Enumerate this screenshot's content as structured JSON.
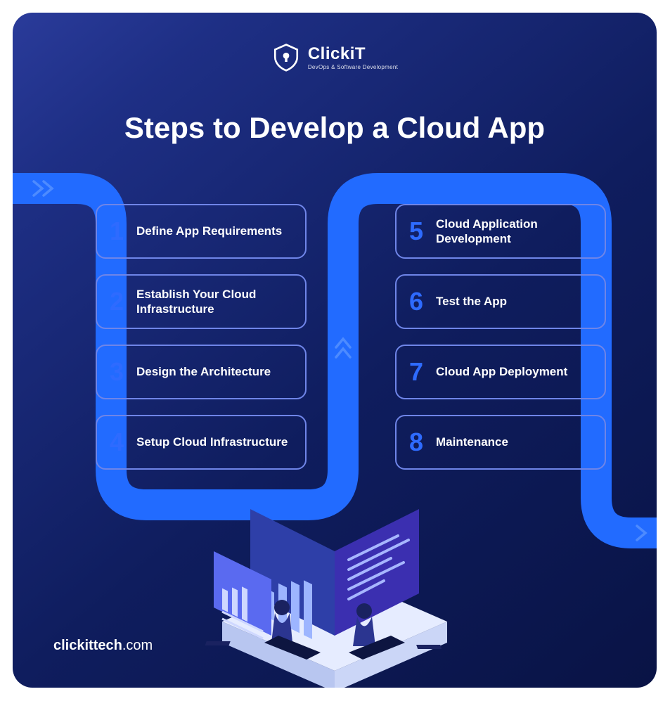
{
  "brand": {
    "name": "ClickiT",
    "tagline": "DevOps & Software Development"
  },
  "title": "Steps to Develop a Cloud App",
  "steps_left": [
    {
      "num": "1",
      "label": "Define App Requirements"
    },
    {
      "num": "2",
      "label": "Establish Your Cloud Infrastructure"
    },
    {
      "num": "3",
      "label": "Design the Architecture"
    },
    {
      "num": "4",
      "label": "Setup Cloud Infrastructure"
    }
  ],
  "steps_right": [
    {
      "num": "5",
      "label": "Cloud Application Development"
    },
    {
      "num": "6",
      "label": "Test the App"
    },
    {
      "num": "7",
      "label": "Cloud App Deployment"
    },
    {
      "num": "8",
      "label": "Maintenance"
    }
  ],
  "footer": {
    "bold": "clickittech",
    "rest": ".com"
  },
  "colors": {
    "bg_start": "#2a3b9a",
    "bg_end": "#091345",
    "flow": "#226bff",
    "border": "#6f85e8",
    "num": "#2e6bff"
  }
}
